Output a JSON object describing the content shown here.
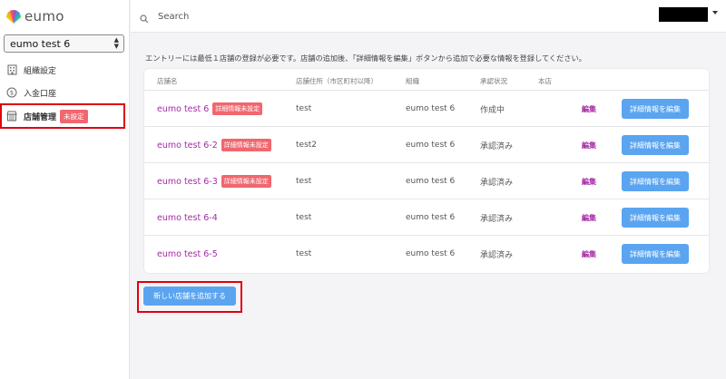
{
  "app": {
    "logo_text": "eumo"
  },
  "sidebar": {
    "org_select": "eumo test 6",
    "items": [
      {
        "label": "組織設定",
        "icon": "building-icon"
      },
      {
        "label": "入金口座",
        "icon": "dollar-circle-icon"
      },
      {
        "label": "店舗管理",
        "icon": "store-icon",
        "badge": "未設定",
        "active": true
      }
    ]
  },
  "header": {
    "search_placeholder": "Search"
  },
  "main": {
    "notice": "エントリーには最低１店舗の登録が必要です。店舗の追加後、「詳細情報を編集」ボタンから追加で必要な情報を登録してください。",
    "table": {
      "columns": [
        "店舗名",
        "店舗住所（市区町村以降）",
        "組織",
        "承認状況",
        "本店"
      ],
      "rows": [
        {
          "name": "eumo test 6",
          "badge": "詳細情報未設定",
          "address": "test",
          "org": "eumo test 6",
          "status": "作成中",
          "edit": "編集",
          "detail": "詳細情報を編集"
        },
        {
          "name": "eumo test 6-2",
          "badge": "詳細情報未設定",
          "address": "test2",
          "org": "eumo test 6",
          "status": "承認済み",
          "edit": "編集",
          "detail": "詳細情報を編集"
        },
        {
          "name": "eumo test 6-3",
          "badge": "詳細情報未設定",
          "address": "test",
          "org": "eumo test 6",
          "status": "承認済み",
          "edit": "編集",
          "detail": "詳細情報を編集"
        },
        {
          "name": "eumo test 6-4",
          "address": "test",
          "org": "eumo test 6",
          "status": "承認済み",
          "edit": "編集",
          "detail": "詳細情報を編集"
        },
        {
          "name": "eumo test 6-5",
          "address": "test",
          "org": "eumo test 6",
          "status": "承認済み",
          "edit": "編集",
          "detail": "詳細情報を編集"
        }
      ]
    },
    "add_button": "新しい店舗を追加する"
  },
  "colors": {
    "accent_purple": "#a52aa5",
    "button_blue": "#5aa4f0",
    "badge_red": "#f0676f",
    "highlight_red": "#e0000f"
  }
}
